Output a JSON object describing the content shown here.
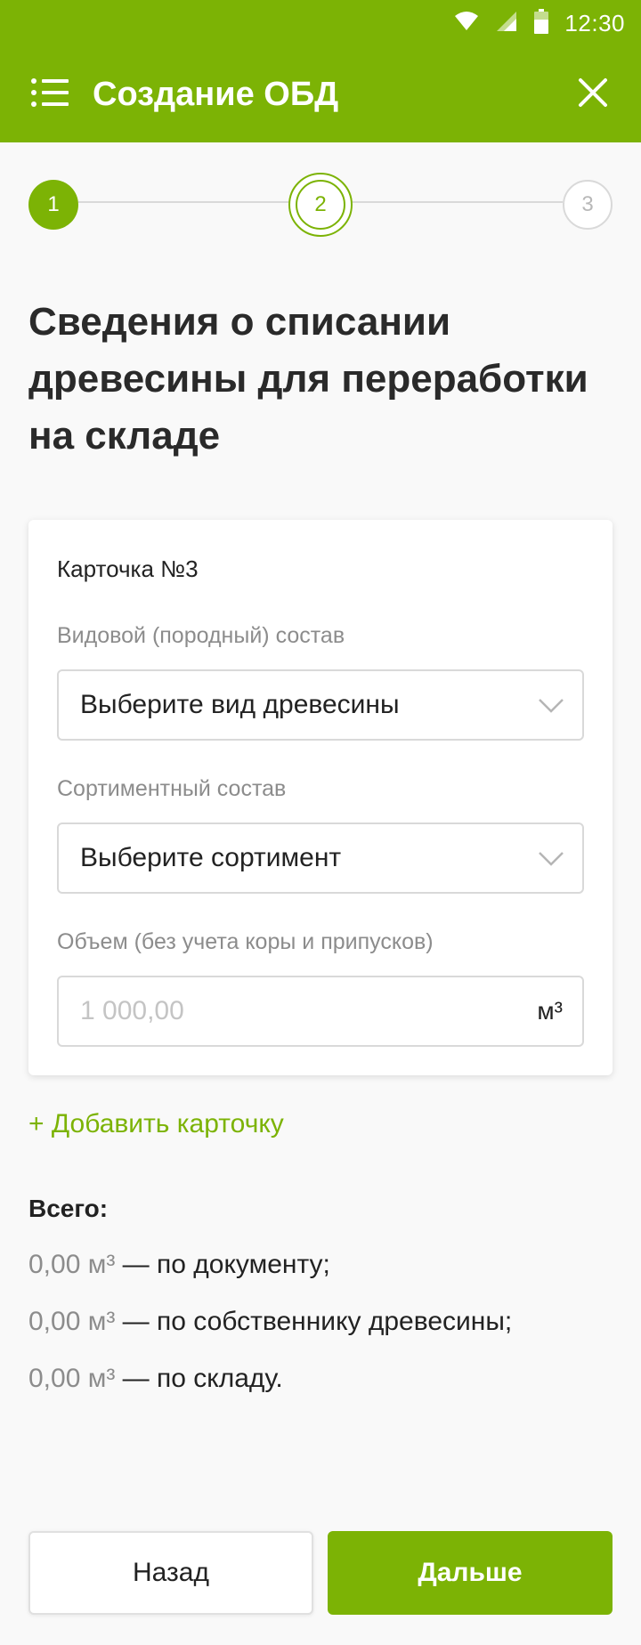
{
  "status_bar": {
    "time": "12:30",
    "icons": [
      "wifi-icon",
      "signal-icon",
      "battery-icon"
    ]
  },
  "toolbar": {
    "title": "Создание ОБД",
    "menu_icon": "list-menu-icon",
    "close_icon": "close-icon"
  },
  "stepper": {
    "steps": [
      {
        "label": "1",
        "state": "done"
      },
      {
        "label": "2",
        "state": "active"
      },
      {
        "label": "3",
        "state": "todo"
      }
    ]
  },
  "heading": "Сведения о списании древесины для переработки на складе",
  "card": {
    "title": "Карточка №3",
    "species": {
      "label": "Видовой (породный) состав",
      "value": "Выберите вид древесины"
    },
    "assortment": {
      "label": "Сортиментный состав",
      "value": "Выберите сортимент"
    },
    "volume": {
      "label": "Объем (без учета коры и припусков)",
      "placeholder": "1 000,00",
      "unit": "м³"
    }
  },
  "add_card_label": "+ Добавить карточку",
  "totals": {
    "title": "Всего:",
    "rows": [
      {
        "value": "0,00 м³",
        "text": " — по документу;"
      },
      {
        "value": "0,00 м³",
        "text": " — по собственнику древесины;"
      },
      {
        "value": "0,00 м³",
        "text": " — по складу."
      }
    ]
  },
  "buttons": {
    "back": "Назад",
    "next": "Дальше"
  },
  "colors": {
    "accent": "#7cb305",
    "background": "#f9f9f9"
  }
}
